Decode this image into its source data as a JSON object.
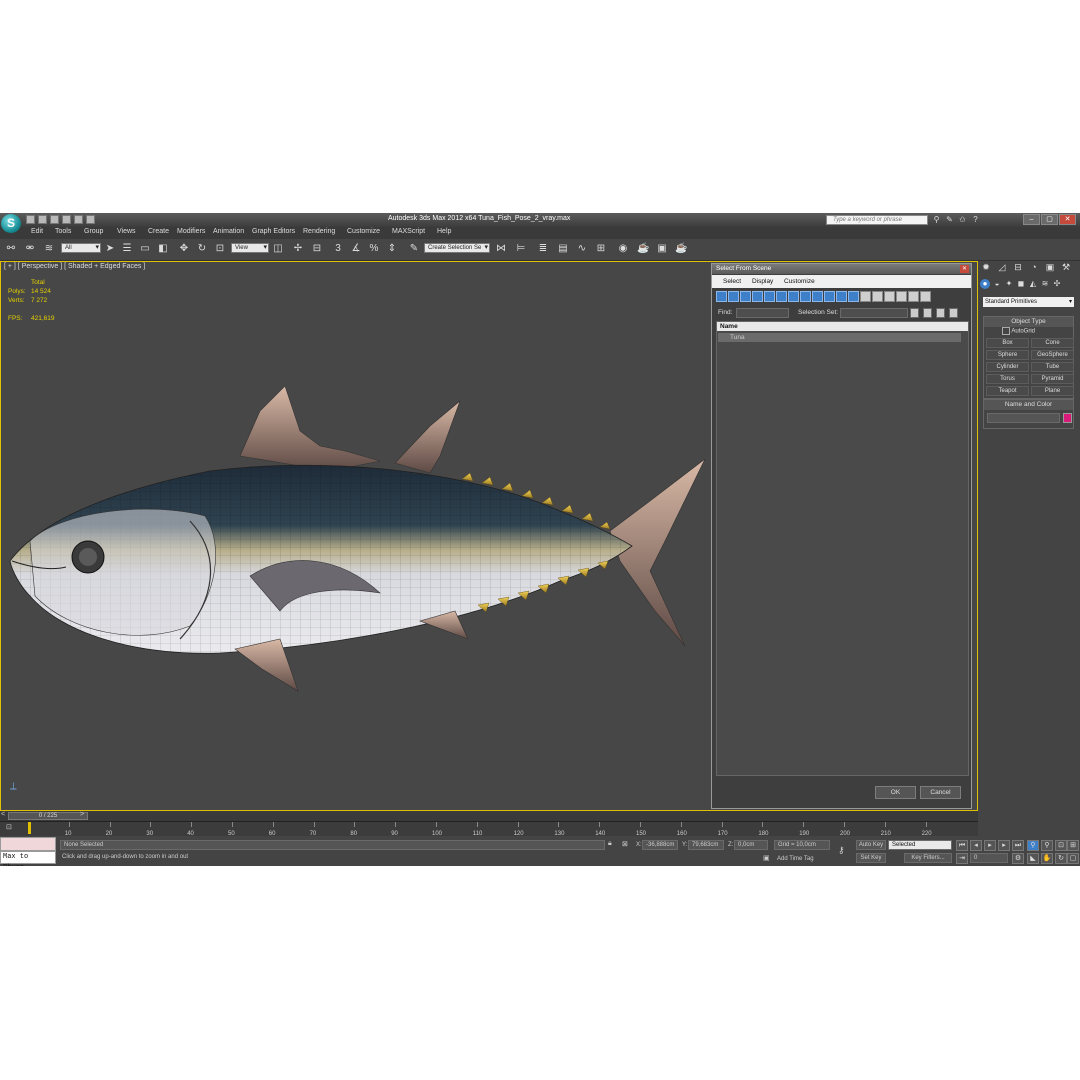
{
  "window": {
    "title": "Autodesk 3ds Max  2012 x64     Tuna_Fish_Pose_2_vray.max",
    "search_placeholder": "Type a keyword or phrase"
  },
  "menu": [
    "Edit",
    "Tools",
    "Group",
    "Views",
    "Create",
    "Modifiers",
    "Animation",
    "Graph Editors",
    "Rendering",
    "Customize",
    "MAXScript",
    "Help"
  ],
  "toolbar": {
    "filter_value": "All",
    "view_value": "View",
    "selection_set_value": "Create Selection Se",
    "numbers": "3"
  },
  "viewport": {
    "label": "[ + ] [ Perspective ] [ Shaded + Edged Faces ]",
    "stats_header": "Total",
    "polys_label": "Polys:",
    "polys_value": "14 524",
    "verts_label": "Verts:",
    "verts_value": "7 272",
    "fps_label": "FPS:",
    "fps_value": "421,619"
  },
  "dialog": {
    "title": "Select From Scene",
    "menu": [
      "Select",
      "Display",
      "Customize"
    ],
    "find_label": "Find:",
    "selection_set_label": "Selection Set:",
    "column_name": "Name",
    "items": [
      "Tuna"
    ],
    "ok_label": "OK",
    "cancel_label": "Cancel"
  },
  "command_panel": {
    "dropdown": "Standard Primitives",
    "object_type_title": "Object Type",
    "autogrid_label": "AutoGrid",
    "primitives": [
      "Box",
      "Cone",
      "Sphere",
      "GeoSphere",
      "Cylinder",
      "Tube",
      "Torus",
      "Pyramid",
      "Teapot",
      "Plane"
    ],
    "name_color_title": "Name and Color",
    "object_color": "#d81b78"
  },
  "timeline": {
    "slider_label": "0 / 225",
    "ticks": [
      "10",
      "20",
      "30",
      "40",
      "50",
      "60",
      "70",
      "80",
      "90",
      "100",
      "110",
      "120",
      "130",
      "140",
      "150",
      "160",
      "170",
      "180",
      "190",
      "200",
      "210",
      "220"
    ]
  },
  "status": {
    "maxscript_line": "Max to Physc.",
    "selection": "None Selected",
    "prompt": "Click and drag up-and-down to zoom in and out",
    "x_label": "X:",
    "x_value": "-36,888cm",
    "y_label": "Y:",
    "y_value": "79,683cm",
    "z_label": "Z:",
    "z_value": "0,0cm",
    "grid": "Grid = 10,0cm",
    "add_time_tag": "Add Time Tag",
    "auto_key": "Auto Key",
    "selected_value": "Selected",
    "set_key": "Set Key",
    "key_filters": "Key Filters...",
    "frame_value": "0"
  },
  "colors": {
    "accent": "#3e7fc9",
    "viewport_border": "#e0c000",
    "stats_text": "#e6d000"
  }
}
